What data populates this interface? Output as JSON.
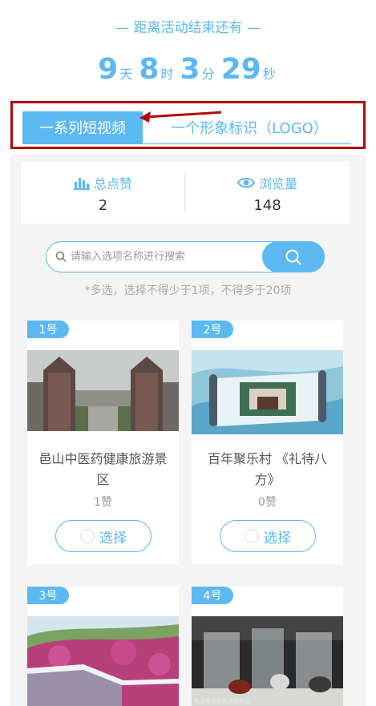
{
  "countdown": {
    "title": "— 距离活动结束还有 —",
    "days": "9",
    "days_unit": "天",
    "hours": "8",
    "hours_unit": "时",
    "minutes": "3",
    "minutes_unit": "分",
    "seconds": "29",
    "seconds_unit": "秒"
  },
  "tabs": [
    {
      "label": "一系列短视频",
      "active": true
    },
    {
      "label": "一个形象标识（LOGO）",
      "active": false
    }
  ],
  "stats": {
    "likes_label": "总点赞",
    "likes_value": "2",
    "views_label": "浏览量",
    "views_value": "148"
  },
  "search": {
    "placeholder": "请输入选项名称进行搜索"
  },
  "hint": "*多选，选择不得少于1项，不得多于20项",
  "choose_label": "选择",
  "cards": [
    {
      "badge": "1号",
      "title": "邑山中医药健康旅游景区",
      "likes": "1赞"
    },
    {
      "badge": "2号",
      "title": "百年聚乐村 《礼待八方》",
      "likes": "0赞"
    },
    {
      "badge": "3号"
    },
    {
      "badge": "4号",
      "thumb_caption": "邑山市中医药文化中心"
    }
  ],
  "colors": {
    "accent": "#5bb8f0",
    "highlight_box": "#b0090e",
    "background": "#f4f4f4"
  }
}
